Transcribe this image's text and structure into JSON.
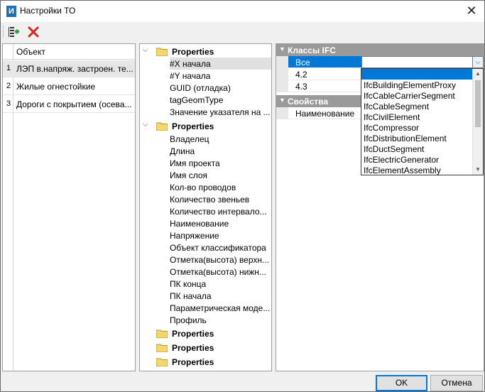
{
  "window": {
    "title": "Настройки ТО",
    "app_icon_letter": "И"
  },
  "toolbar": {
    "add_icon": "add-item-icon",
    "delete_icon": "delete-x-icon"
  },
  "objects_panel": {
    "header": "Объект",
    "rows": [
      {
        "index": "1",
        "label": "ЛЭП в.напряж. застроен. те..."
      },
      {
        "index": "2",
        "label": "Жилые огнестойкие"
      },
      {
        "index": "3",
        "label": "Дороги с покрытием (осева..."
      }
    ]
  },
  "tree_panel": {
    "group1": {
      "label": "Properties",
      "items": [
        "#X начала",
        "#Y начала",
        "GUID (отладка)",
        "tagGeomType",
        "Значение указателя на ..."
      ]
    },
    "group2": {
      "label": "Properties",
      "items": [
        "Владелец",
        "Длина",
        "Имя проекта",
        "Имя слоя",
        "Кол-во проводов",
        "Количество звеньев",
        "Количество интервало...",
        "Наименование",
        "Напряжение",
        "Объект классификатора",
        "Отметка(высота) верхн...",
        "Отметка(высота) нижн...",
        "ПК конца",
        "ПК начала",
        "Параметрическая моде...",
        "Профиль"
      ]
    },
    "collapsed_groups": [
      "Properties",
      "Properties",
      "Properties"
    ]
  },
  "properties_panel": {
    "category_ifc": "Классы IFC",
    "ifc_rows": [
      {
        "key": "Все",
        "value": ""
      },
      {
        "key": "4.2",
        "value": ""
      },
      {
        "key": "4.3",
        "value": ""
      }
    ],
    "category_props": "Свойства",
    "prop_rows": [
      {
        "key": "Наименование",
        "value": ""
      }
    ]
  },
  "dropdown": {
    "options": [
      "",
      "IfcBuildingElementProxy",
      "IfcCableCarrierSegment",
      "IfcCableSegment",
      "IfcCivilElement",
      "IfcCompressor",
      "IfcDistributionElement",
      "IfcDuctSegment",
      "IfcElectricGenerator",
      "IfcElementAssembly"
    ]
  },
  "buttons": {
    "ok": "OK",
    "cancel": "Отмена"
  },
  "colors": {
    "selection": "#0078d7",
    "category_bg": "#9a9a9a",
    "folder": "#f5d76e"
  }
}
